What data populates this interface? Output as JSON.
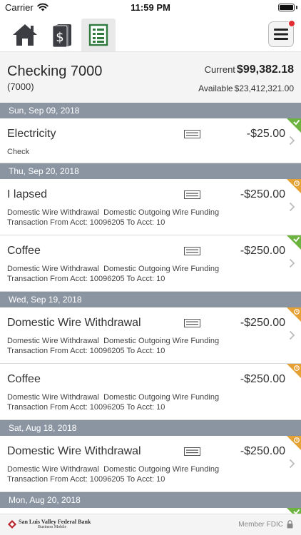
{
  "status_bar": {
    "carrier": "Carrier",
    "time": "11:59 PM"
  },
  "nav": {
    "tabs": [
      {
        "name": "home-icon",
        "active": false
      },
      {
        "name": "accounts-icon",
        "active": false
      },
      {
        "name": "register-icon",
        "active": true
      }
    ],
    "menu_badge": true
  },
  "account": {
    "name": "Checking 7000",
    "number": "(7000)",
    "current_label": "Current",
    "current_value": "$99,382.18",
    "available_label": "Available",
    "available_value": "$23,412,321.00"
  },
  "groups": [
    {
      "date": "Sun, Sep 09, 2018",
      "transactions": [
        {
          "title": "Electricity",
          "amount": "-$25.00",
          "check": "Check",
          "memo_icon": true,
          "status": "cleared",
          "status_color": "#6db33f"
        }
      ]
    },
    {
      "date": "Thu, Sep 20, 2018",
      "transactions": [
        {
          "title": "I lapsed",
          "amount": "-$250.00",
          "line1": "Domestic Wire Withdrawal  Domestic Outgoing Wire Funding",
          "line2": "Transaction From Acct: 10096205 To Acct: 10",
          "memo_icon": true,
          "status": "pending",
          "status_color": "#e6a135"
        },
        {
          "title": "Coffee",
          "amount": "-$250.00",
          "line1": "Domestic Wire Withdrawal  Domestic Outgoing Wire Funding",
          "line2": "Transaction From Acct: 10096205 To Acct: 10",
          "memo_icon": true,
          "status": "cleared",
          "status_color": "#6db33f"
        }
      ]
    },
    {
      "date": "Wed, Sep 19, 2018",
      "transactions": [
        {
          "title": "Domestic Wire Withdrawal",
          "amount": "-$250.00",
          "line1": "Domestic Wire Withdrawal  Domestic Outgoing Wire Funding",
          "line2": "Transaction From Acct: 10096205 To Acct: 10",
          "memo_icon": true,
          "status": "pending",
          "status_color": "#e6a135"
        },
        {
          "title": "Coffee",
          "amount": "-$250.00",
          "line1": "Domestic Wire Withdrawal  Domestic Outgoing Wire Funding",
          "line2": "Transaction From Acct: 10096205 To Acct: 10",
          "memo_icon": false,
          "status": "pending",
          "status_color": "#e6a135"
        }
      ]
    },
    {
      "date": "Sat, Aug 18, 2018",
      "transactions": [
        {
          "title": "Domestic Wire Withdrawal",
          "amount": "-$250.00",
          "line1": "Domestic Wire Withdrawal  Domestic Outgoing Wire Funding",
          "line2": "Transaction From Acct: 10096205 To Acct: 10",
          "memo_icon": true,
          "status": "pending",
          "status_color": "#e6a135"
        }
      ]
    },
    {
      "date": "Mon, Aug 20, 2018",
      "transactions": [
        {
          "title": "",
          "amount": "",
          "memo_icon": false,
          "status": "cleared",
          "status_color": "#6db33f",
          "partial": true
        }
      ]
    }
  ],
  "footer": {
    "bank_name": "San Luis Valley Federal Bank",
    "bank_sub": "Business Mobile",
    "member_fdic": "Member FDIC"
  },
  "colors": {
    "date_header_bg": "#8b95a2",
    "cleared": "#6db33f",
    "pending": "#e6a135",
    "register_tab_green": "#2f7a3c",
    "badge": "#e12f33"
  }
}
